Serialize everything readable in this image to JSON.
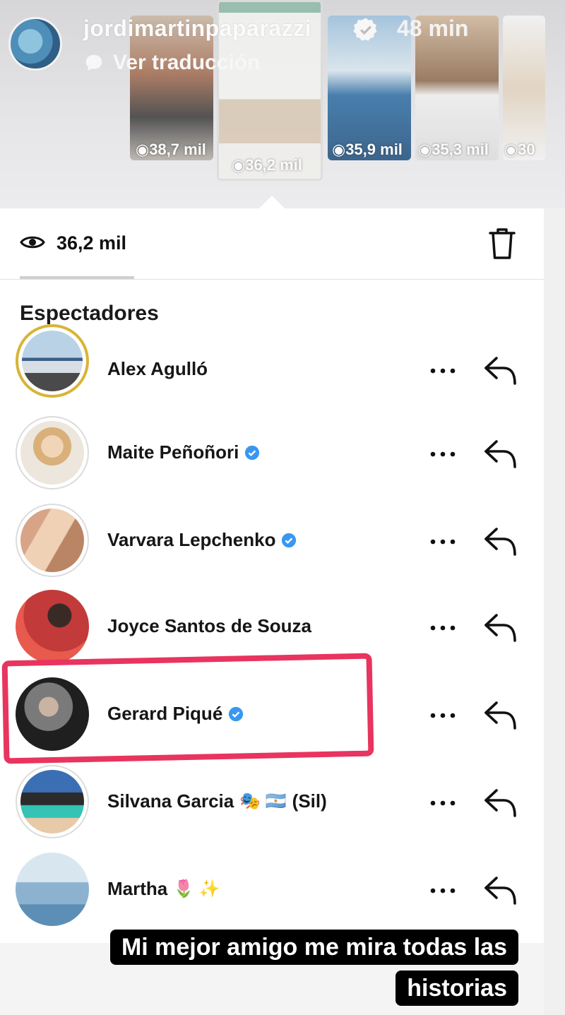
{
  "story_header": {
    "username": "jordimartinpaparazzi",
    "time_ago": "48 min",
    "translate_label": "Ver traducción"
  },
  "story_thumbnails": [
    {
      "views": "38,7 mil",
      "selected": false
    },
    {
      "views": "36,2 mil",
      "selected": true
    },
    {
      "views": "35,9 mil",
      "selected": false
    },
    {
      "views": "35,3 mil",
      "selected": false
    },
    {
      "views": "30",
      "selected": false
    }
  ],
  "viewers_panel": {
    "views_count": "36,2 mil",
    "section_title": "Espectadores",
    "viewers": [
      {
        "name": "Alex Agulló",
        "verified": false,
        "emoji": ""
      },
      {
        "name": "Maite Peñoñori",
        "verified": true,
        "emoji": ""
      },
      {
        "name": "Varvara Lepchenko",
        "verified": true,
        "emoji": ""
      },
      {
        "name": "Joyce Santos de Souza",
        "verified": false,
        "emoji": ""
      },
      {
        "name": "Gerard Piqué",
        "verified": true,
        "emoji": ""
      },
      {
        "name": "Silvana Garcia",
        "verified": false,
        "emoji": "🎭 🇦🇷",
        "suffix": "(Sil)"
      },
      {
        "name": "Martha",
        "verified": false,
        "emoji": "🌷 ✨"
      }
    ]
  },
  "caption": {
    "line1": "Mi mejor amigo me mira todas las",
    "line2": "historias"
  },
  "colors": {
    "highlight": "#e8345f",
    "verified_blue": "#3897f0",
    "caption_bg": "#000000"
  },
  "icons": {
    "eye": "eye-icon",
    "trash": "trash-icon",
    "more": "more-horizontal-icon",
    "reply": "reply-arrow-icon",
    "verified": "verified-badge-icon"
  }
}
